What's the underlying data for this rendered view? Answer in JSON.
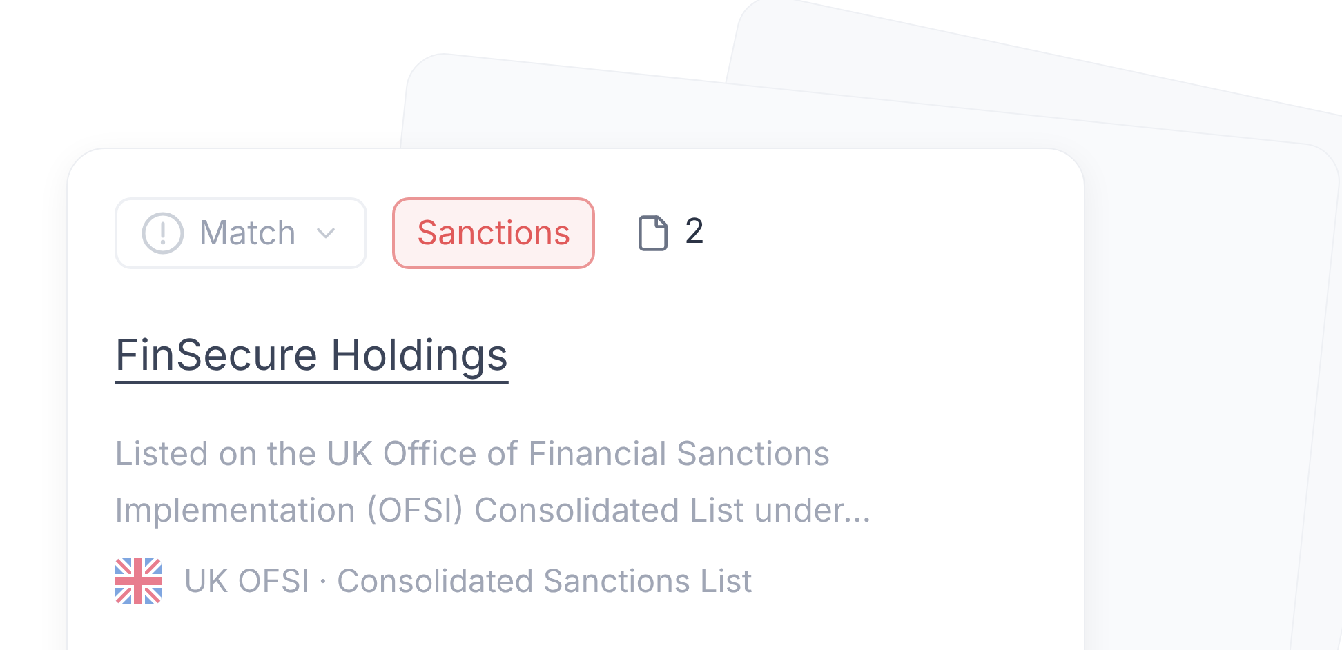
{
  "card": {
    "status": {
      "label": "Match",
      "expanded": false
    },
    "tag": {
      "label": "Sanctions",
      "color": "#e05a5a"
    },
    "documents": {
      "count": "2"
    },
    "title": "FinSecure Holdings",
    "description": "Listed on the UK Office of Financial Sanctions Implementation (OFSI) Consolidated List under...",
    "source": "UK OFSI · Consolidated Sanctions List"
  }
}
